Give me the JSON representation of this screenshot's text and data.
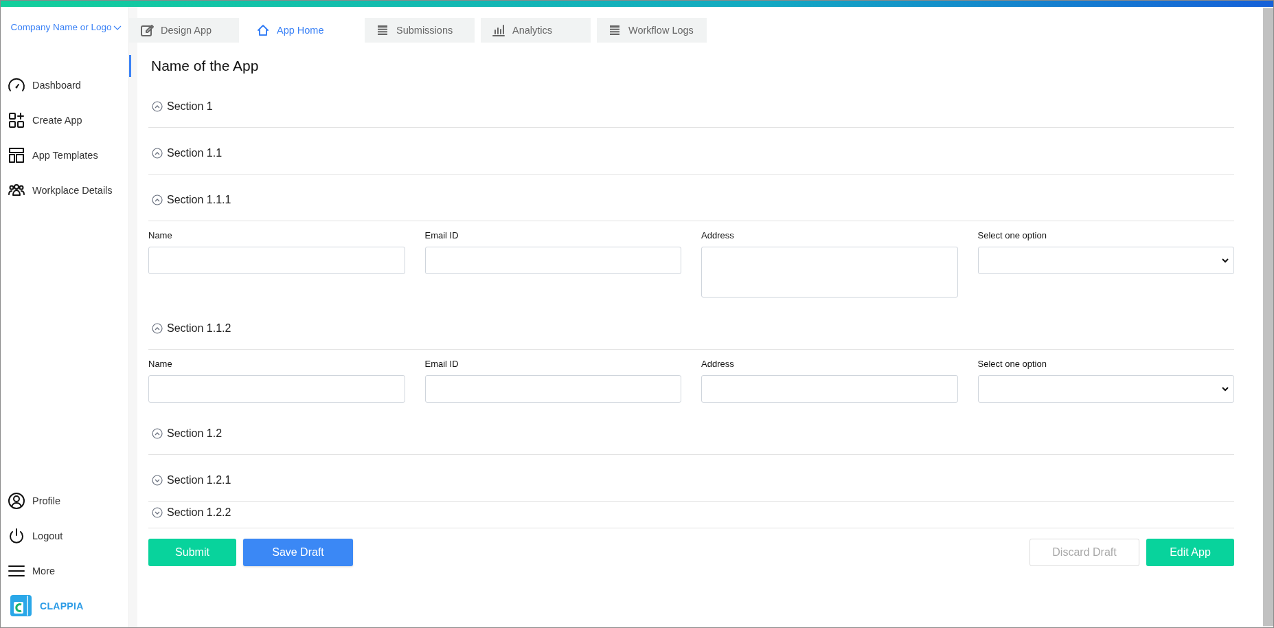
{
  "sidebar": {
    "company": "Company Name or Logo",
    "nav": [
      {
        "label": "Dashboard"
      },
      {
        "label": "Create App"
      },
      {
        "label": "App Templates"
      },
      {
        "label": "Workplace Details"
      }
    ],
    "bottom_nav": [
      {
        "label": "Profile"
      },
      {
        "label": "Logout"
      },
      {
        "label": "More"
      }
    ],
    "brand": "CLAPPIA"
  },
  "tabs": [
    {
      "label": "Design App",
      "selected": false
    },
    {
      "label": "App Home",
      "selected": true
    },
    {
      "label": "Submissions",
      "selected": false
    },
    {
      "label": "Analytics",
      "selected": false
    },
    {
      "label": "Workflow Logs",
      "selected": false
    }
  ],
  "app_title": "Name of the App",
  "sections": [
    {
      "title": "Section 1",
      "expanded": true
    },
    {
      "title": "Section 1.1",
      "expanded": true
    },
    {
      "title": "Section 1.1.1",
      "expanded": true,
      "fields": [
        {
          "label": "Name",
          "kind": "text"
        },
        {
          "label": "Email ID",
          "kind": "text"
        },
        {
          "label": "Address",
          "kind": "textarea"
        },
        {
          "label": "Select one option",
          "kind": "select"
        }
      ]
    },
    {
      "title": "Section 1.1.2",
      "expanded": true,
      "fields": [
        {
          "label": "Name",
          "kind": "text"
        },
        {
          "label": "Email ID",
          "kind": "text"
        },
        {
          "label": "Address",
          "kind": "text"
        },
        {
          "label": "Select one option",
          "kind": "select"
        }
      ]
    },
    {
      "title": "Section 1.2",
      "expanded": true
    },
    {
      "title": "Section 1.2.1",
      "expanded": false
    },
    {
      "title": "Section 1.2.2",
      "expanded": false
    }
  ],
  "actions": {
    "left": [
      {
        "label": "Submit",
        "kind": "primary",
        "disabled": false
      },
      {
        "label": "Save Draft",
        "kind": "secondary",
        "disabled": false
      }
    ],
    "right": [
      {
        "label": "Discard Draft",
        "kind": "outline",
        "disabled": true
      },
      {
        "label": "Edit App",
        "kind": "primary",
        "disabled": false
      }
    ]
  }
}
